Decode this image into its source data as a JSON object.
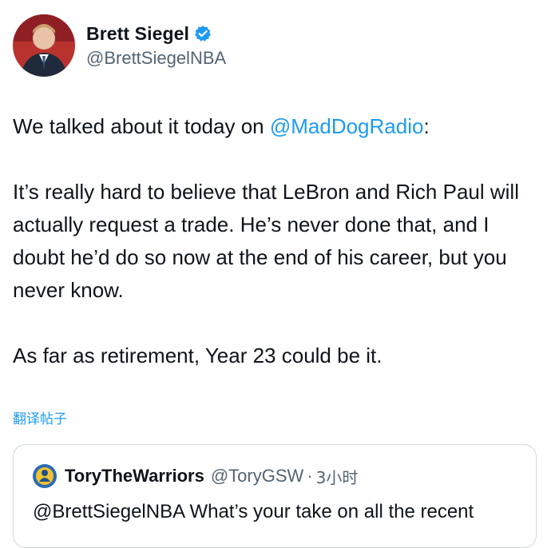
{
  "tweet": {
    "author": {
      "display_name": "Brett Siegel",
      "handle": "@BrettSiegelNBA",
      "verified": true
    },
    "body": {
      "p1_prefix": "We talked about it today on ",
      "p1_mention": "@MadDogRadio",
      "p1_suffix": ":",
      "p2": "It’s really hard to believe that LeBron and Rich Paul will actually request a trade. He’s never done that, and I doubt he’d do so now at the end of his career, but you never know.",
      "p3": "As far as retirement, Year 23 could be it."
    },
    "translate_label": "翻译帖子"
  },
  "quote": {
    "display_name": "ToryTheWarriors",
    "handle": "@ToryGSW",
    "separator": "·",
    "time": "3小时",
    "text": "@BrettSiegelNBA What’s your take on all the recent"
  },
  "colors": {
    "accent": "#1d9bf0",
    "text": "#0f1419",
    "secondary": "#536471",
    "border": "#cfd9de"
  },
  "icons": {
    "verified": "verified-badge-icon"
  }
}
